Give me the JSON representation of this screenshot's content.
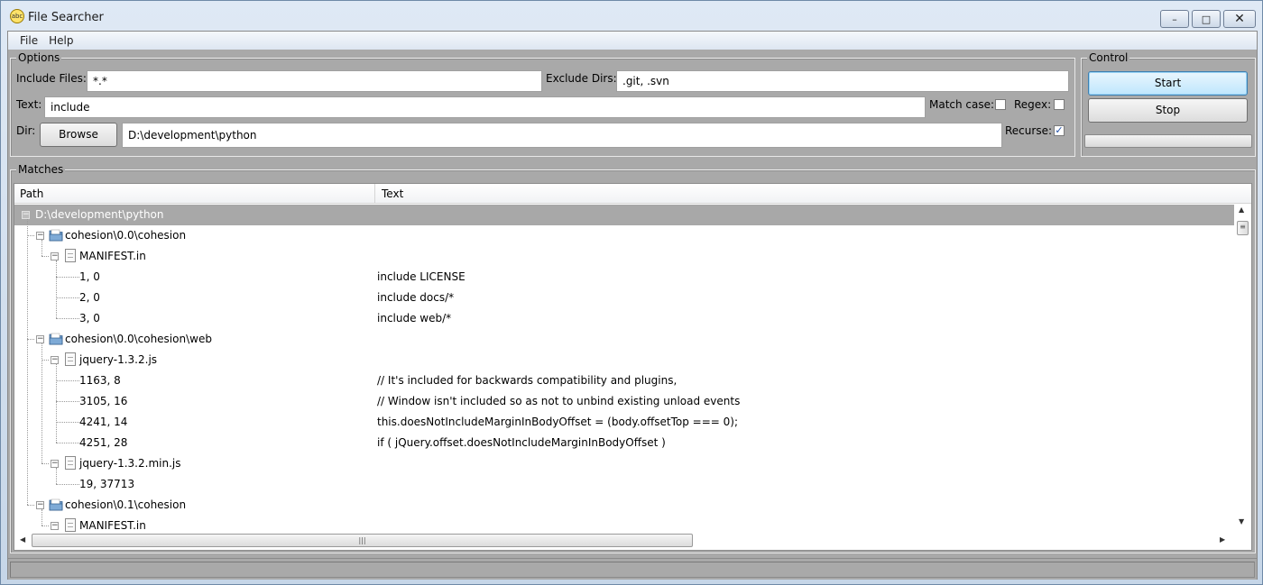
{
  "window": {
    "title": "File Searcher",
    "app_icon_text": "abc",
    "minimize": "–",
    "maximize": "□",
    "close": "✕"
  },
  "menu": [
    {
      "label": "File"
    },
    {
      "label": "Help"
    }
  ],
  "options": {
    "legend": "Options",
    "include_files_label": "Include Files:",
    "include_files_value": "*.*",
    "exclude_dirs_label": "Exclude Dirs:",
    "exclude_dirs_value": ".git, .svn",
    "text_label": "Text:",
    "text_value": "include",
    "match_case_label": "Match case:",
    "match_case_checked": false,
    "regex_label": "Regex:",
    "regex_checked": false,
    "dir_label": "Dir:",
    "browse_label": "Browse",
    "dir_value": "D:\\development\\python",
    "recurse_label": "Recurse:",
    "recurse_checked": true,
    "check_glyph": "✓"
  },
  "control": {
    "legend": "Control",
    "start_label": "Start",
    "stop_label": "Stop",
    "progress": 0
  },
  "matches": {
    "legend": "Matches",
    "columns": [
      "Path",
      "Text"
    ],
    "rows": [
      {
        "path": "D:\\development\\python",
        "text": "",
        "type": "root",
        "expander": "−"
      },
      {
        "path": "cohesion\\0.0\\cohesion",
        "text": "",
        "type": "folder",
        "expander": "−"
      },
      {
        "path": "MANIFEST.in",
        "text": "",
        "type": "file",
        "expander": "−"
      },
      {
        "path": "1, 0",
        "text": "include LICENSE",
        "type": "match"
      },
      {
        "path": "2, 0",
        "text": "include docs/*",
        "type": "match"
      },
      {
        "path": "3, 0",
        "text": "include web/*",
        "type": "match"
      },
      {
        "path": "cohesion\\0.0\\cohesion\\web",
        "text": "",
        "type": "folder",
        "expander": "−"
      },
      {
        "path": "jquery-1.3.2.js",
        "text": "",
        "type": "file",
        "expander": "−"
      },
      {
        "path": "1163, 8",
        "text": "// It's included for backwards compatibility and plugins,",
        "type": "match"
      },
      {
        "path": "3105, 16",
        "text": "// Window isn't included so as not to unbind existing unload events",
        "type": "match"
      },
      {
        "path": "4241, 14",
        "text": "this.doesNotIncludeMarginInBodyOffset = (body.offsetTop === 0);",
        "type": "match"
      },
      {
        "path": "4251, 28",
        "text": "if ( jQuery.offset.doesNotIncludeMarginInBodyOffset )",
        "type": "match"
      },
      {
        "path": "jquery-1.3.2.min.js",
        "text": "",
        "type": "file",
        "expander": "−"
      },
      {
        "path": "19, 37713",
        "text": "",
        "type": "match"
      },
      {
        "path": "cohesion\\0.1\\cohesion",
        "text": "",
        "type": "folder",
        "expander": "−"
      },
      {
        "path": "MANIFEST.in",
        "text": "",
        "type": "file",
        "expander": "−"
      }
    ],
    "scroll_up": "▲",
    "scroll_down": "▼",
    "scroll_left": "◀",
    "scroll_right": "▶",
    "thumb_grip": "|||",
    "vthumb_grip": "≡"
  },
  "colors": {
    "selected_row": "#a8a8a8",
    "primary_button": "#bee6fd",
    "panel": "#a9a9a9"
  }
}
